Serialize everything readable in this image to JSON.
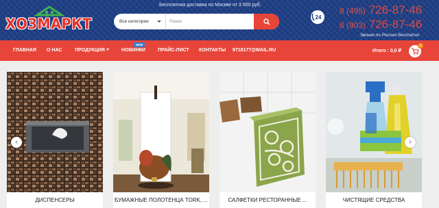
{
  "header": {
    "logo_text": "ХОЗМАРКТ",
    "shipping_note": "Бесплатная доставка по Москве от 3 000 руб.",
    "search": {
      "category": "Все категории",
      "placeholder": "Поиск"
    },
    "support_badge": "24",
    "phones": [
      {
        "code": "8 (495)",
        "number": "726-87-46"
      },
      {
        "code": "8 (903)",
        "number": "726-87-46"
      }
    ],
    "free_calls_note": "Звонки по России бесплатно"
  },
  "nav": {
    "items": [
      "ГЛАВНАЯ",
      "О НАС",
      "ПРОДУКЦИЯ",
      "НОВИНКИ",
      "ПРАЙС-ЛИСТ",
      "КОНТАКТЫ",
      "9718177@MAIL.RU"
    ],
    "new_badge": "NEW",
    "total_label": "Итого : 0,0 ₽",
    "cart_count": "0"
  },
  "products": [
    {
      "caption": "ДИСПЕНСЕРЫ"
    },
    {
      "caption": "БУМАЖНЫЕ ПОЛОТЕНЦА TORK, ..."
    },
    {
      "caption": "САЛФЕТКИ РЕСТОРАННЫЕ ..."
    },
    {
      "caption": "ЧИСТЯЩИЕ СРЕДСТВА"
    }
  ],
  "carousel": {
    "prev": "‹",
    "next": "›"
  },
  "colors": {
    "header_bg": "#1f3f86",
    "accent_red": "#e8453a",
    "badge_blue": "#2f7fd6",
    "cart_badge": "#f28c1e"
  },
  "icons": [
    "house-icon",
    "search-icon",
    "support-24-icon",
    "cart-icon",
    "chevron-left-icon",
    "chevron-right-icon",
    "dropdown-caret-icon"
  ]
}
